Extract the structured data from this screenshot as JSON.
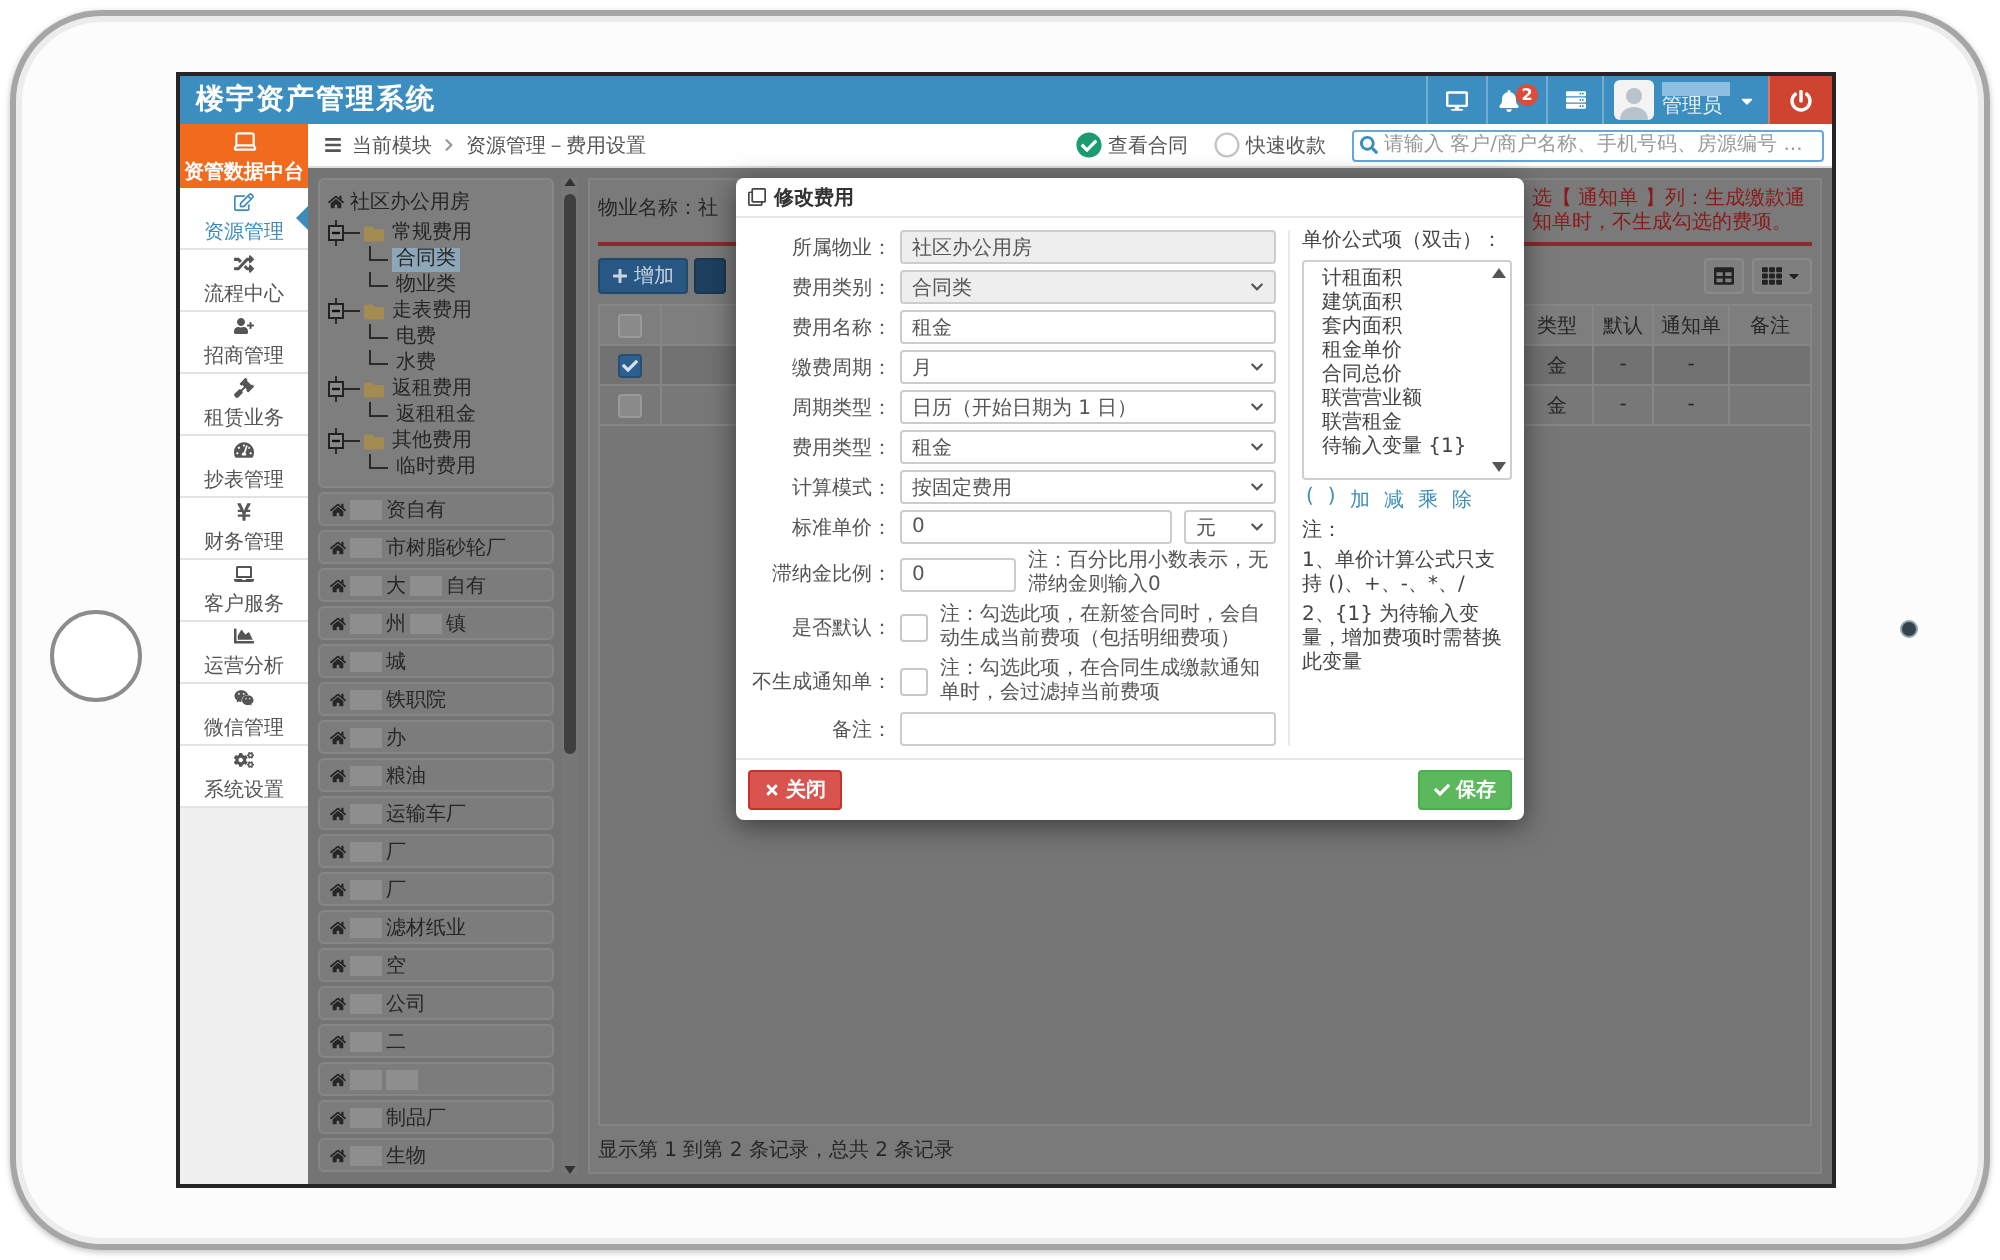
{
  "window": {
    "title": "楼宇资产管理系统"
  },
  "header": {
    "notification_count": "2",
    "user_role": "管理员"
  },
  "sidebar": {
    "brand": "资管数据中台",
    "items": [
      {
        "label": "资源管理",
        "selected": true
      },
      {
        "label": "流程中心",
        "selected": false
      },
      {
        "label": "招商管理",
        "selected": false
      },
      {
        "label": "租赁业务",
        "selected": false
      },
      {
        "label": "抄表管理",
        "selected": false
      },
      {
        "label": "财务管理",
        "selected": false
      },
      {
        "label": "客户服务",
        "selected": false
      },
      {
        "label": "运营分析",
        "selected": false
      },
      {
        "label": "微信管理",
        "selected": false
      },
      {
        "label": "系统设置",
        "selected": false
      }
    ]
  },
  "breadcrumb": {
    "module": "当前模块",
    "page": "资源管理－费用设置"
  },
  "quick_links": [
    {
      "label": "查看合同",
      "checked": true
    },
    {
      "label": "快速收款",
      "checked": false
    }
  ],
  "search": {
    "placeholder": "请输入 客户/商户名称、手机号码、房源编号 ..."
  },
  "tree": {
    "root": "社区办公用房",
    "children": [
      {
        "label": "常规费用",
        "expanded": true,
        "selected": false,
        "children": [
          {
            "label": "合同类",
            "selected": true
          },
          {
            "label": "物业类",
            "selected": false
          }
        ]
      },
      {
        "label": "走表费用",
        "expanded": true,
        "selected": false,
        "children": [
          {
            "label": "电费",
            "selected": false
          },
          {
            "label": "水费",
            "selected": false
          }
        ]
      },
      {
        "label": "返租费用",
        "expanded": true,
        "selected": false,
        "children": [
          {
            "label": "返租租金",
            "selected": false
          }
        ]
      },
      {
        "label": "其他费用",
        "expanded": true,
        "selected": false,
        "children": [
          {
            "label": "临时费用",
            "selected": false
          }
        ]
      }
    ]
  },
  "properties": [
    {
      "segments": [
        {
          "kind": "redacted"
        },
        {
          "kind": "text",
          "text": "资自有"
        }
      ]
    },
    {
      "segments": [
        {
          "kind": "redacted"
        },
        {
          "kind": "text",
          "text": "市树脂砂轮厂"
        }
      ]
    },
    {
      "segments": [
        {
          "kind": "redacted"
        },
        {
          "kind": "text",
          "text": "大"
        },
        {
          "kind": "redacted"
        },
        {
          "kind": "text",
          "text": "自有"
        }
      ]
    },
    {
      "segments": [
        {
          "kind": "redacted"
        },
        {
          "kind": "text",
          "text": "州"
        },
        {
          "kind": "redacted"
        },
        {
          "kind": "text",
          "text": "镇"
        }
      ]
    },
    {
      "segments": [
        {
          "kind": "redacted"
        },
        {
          "kind": "text",
          "text": "城"
        }
      ]
    },
    {
      "segments": [
        {
          "kind": "redacted"
        },
        {
          "kind": "text",
          "text": "铁职院"
        }
      ]
    },
    {
      "segments": [
        {
          "kind": "redacted"
        },
        {
          "kind": "text",
          "text": "办"
        }
      ]
    },
    {
      "segments": [
        {
          "kind": "redacted"
        },
        {
          "kind": "text",
          "text": "粮油"
        }
      ]
    },
    {
      "segments": [
        {
          "kind": "redacted"
        },
        {
          "kind": "text",
          "text": "运输车厂"
        }
      ]
    },
    {
      "segments": [
        {
          "kind": "redacted"
        },
        {
          "kind": "text",
          "text": "厂"
        }
      ]
    },
    {
      "segments": [
        {
          "kind": "redacted"
        },
        {
          "kind": "text",
          "text": "厂"
        }
      ]
    },
    {
      "segments": [
        {
          "kind": "redacted"
        },
        {
          "kind": "text",
          "text": "滤材纸业"
        }
      ]
    },
    {
      "segments": [
        {
          "kind": "redacted"
        },
        {
          "kind": "text",
          "text": "空"
        }
      ]
    },
    {
      "segments": [
        {
          "kind": "redacted"
        },
        {
          "kind": "text",
          "text": "公司"
        }
      ]
    },
    {
      "segments": [
        {
          "kind": "redacted"
        },
        {
          "kind": "text",
          "text": "二"
        }
      ]
    },
    {
      "segments": [
        {
          "kind": "redacted"
        },
        {
          "kind": "redacted"
        }
      ]
    },
    {
      "segments": [
        {
          "kind": "redacted"
        },
        {
          "kind": "text",
          "text": "制品厂"
        }
      ]
    },
    {
      "segments": [
        {
          "kind": "redacted"
        },
        {
          "kind": "text",
          "text": "生物"
        }
      ]
    }
  ],
  "fee_page": {
    "property_label": "物业名称：社",
    "notice": "选【 通知单 】列：生成缴款通知单时，不生成勾选的费项。",
    "add_button": "增加"
  },
  "table": {
    "header_checked": false,
    "columns": [
      "类型",
      "默认",
      "通知单",
      "备注"
    ],
    "rows": [
      {
        "selected": true,
        "cells": [
          "金",
          "-",
          "-"
        ]
      },
      {
        "selected": false,
        "cells": [
          "金",
          "-",
          "-"
        ]
      }
    ],
    "footer": "显示第 1 到第 2 条记录，总共 2 条记录"
  },
  "dialog": {
    "title": "修改费用",
    "fields": [
      {
        "label": "所属物业：",
        "kind": "text",
        "value": "社区办公用房",
        "disabled": true
      },
      {
        "label": "费用类别：",
        "kind": "select",
        "value": "合同类",
        "disabled": true
      },
      {
        "label": "费用名称：",
        "kind": "text",
        "value": "租金",
        "disabled": false
      },
      {
        "label": "缴费周期：",
        "kind": "select",
        "value": "月",
        "disabled": false
      },
      {
        "label": "周期类型：",
        "kind": "select",
        "value": "日历（开始日期为 1 日）",
        "disabled": false
      },
      {
        "label": "费用类型：",
        "kind": "select",
        "value": "租金",
        "disabled": false
      },
      {
        "label": "计算模式：",
        "kind": "select",
        "value": "按固定费用",
        "disabled": false
      },
      {
        "label": "标准单价：",
        "kind": "amount",
        "value": "0",
        "unit": "元",
        "disabled": false
      },
      {
        "label": "滞纳金比例：",
        "kind": "text",
        "value": "0",
        "note": "注：百分比用小数表示，无滞纳金则输入0",
        "disabled": false
      },
      {
        "label": "是否默认：",
        "kind": "checkbox",
        "checked": false,
        "note": "注：勾选此项，在新签合同时，会自动生成当前费项（包括明细费项）",
        "disabled": false
      },
      {
        "label": "不生成通知单：",
        "kind": "checkbox",
        "checked": false,
        "note": "注：勾选此项，在合同生成缴款通知单时，会过滤掉当前费项",
        "disabled": false
      },
      {
        "label": "备注：",
        "kind": "text",
        "disabled": false
      }
    ],
    "formula": {
      "label": "单价公式项（双击）：",
      "options": [
        {
          "label": "计租面积",
          "selected": false
        },
        {
          "label": "建筑面积",
          "selected": false
        },
        {
          "label": "套内面积",
          "selected": false
        },
        {
          "label": "租金单价",
          "selected": false
        },
        {
          "label": "合同总价",
          "selected": false
        },
        {
          "label": "联营营业额",
          "selected": false
        },
        {
          "label": "联营租金",
          "selected": false
        },
        {
          "label": "待输入变量 {1}",
          "selected": false
        }
      ],
      "operators": [
        "(",
        ")",
        "加",
        "减",
        "乘",
        "除"
      ],
      "notes_title": "注：",
      "notes": [
        "1、单价计算公式只支持 ()、+、-、*、/",
        "2、{1} 为待输入变量，增加费项时需替换此变量"
      ]
    },
    "buttons": [
      {
        "label": "关闭",
        "kind": "close"
      },
      {
        "label": "保存",
        "kind": "save"
      }
    ]
  }
}
